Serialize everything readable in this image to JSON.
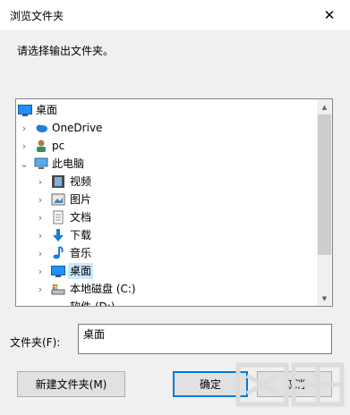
{
  "dialog": {
    "title": "浏览文件夹",
    "prompt": "请选择输出文件夹。"
  },
  "tree": {
    "items": [
      {
        "label": "桌面",
        "icon": "desktop-icon"
      },
      {
        "label": "OneDrive",
        "icon": "onedrive-cloud-icon"
      },
      {
        "label": "pc",
        "icon": "user-icon"
      },
      {
        "label": "此电脑",
        "icon": "this-pc-icon"
      },
      {
        "label": "视频",
        "icon": "videos-folder-icon"
      },
      {
        "label": "图片",
        "icon": "pictures-folder-icon"
      },
      {
        "label": "文档",
        "icon": "documents-folder-icon"
      },
      {
        "label": "下载",
        "icon": "downloads-folder-icon"
      },
      {
        "label": "音乐",
        "icon": "music-folder-icon"
      },
      {
        "label": "桌面",
        "icon": "desktop-icon"
      },
      {
        "label": "本地磁盘 (C:)",
        "icon": "local-disk-icon"
      },
      {
        "label": "软件 (D:)",
        "icon": "drive-icon"
      }
    ],
    "selected": "桌面"
  },
  "folder_field": {
    "label": "文件夹(F):",
    "value": "桌面"
  },
  "buttons": {
    "new_folder": "新建文件夹(M)",
    "ok": "确定",
    "cancel": "取消"
  },
  "colors": {
    "selection": "#cce8ff",
    "default_button_border": "#0078d7",
    "accent_blue": "#1e90ff"
  }
}
